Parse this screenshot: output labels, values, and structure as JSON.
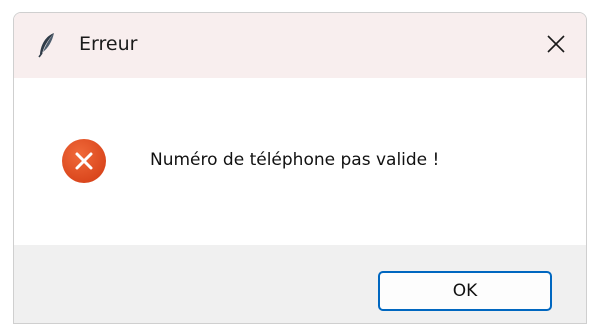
{
  "dialog": {
    "title": "Erreur",
    "message": "Numéro de téléphone pas valide !",
    "ok_label": "OK",
    "app_icon": "feather-icon",
    "status_icon": "error-x-icon",
    "close_icon": "close-icon"
  },
  "colors": {
    "titlebar_bg": "#f8eeee",
    "footer_bg": "#f0f0f0",
    "error_icon": "#e04a1f",
    "accent": "#0067c0"
  }
}
